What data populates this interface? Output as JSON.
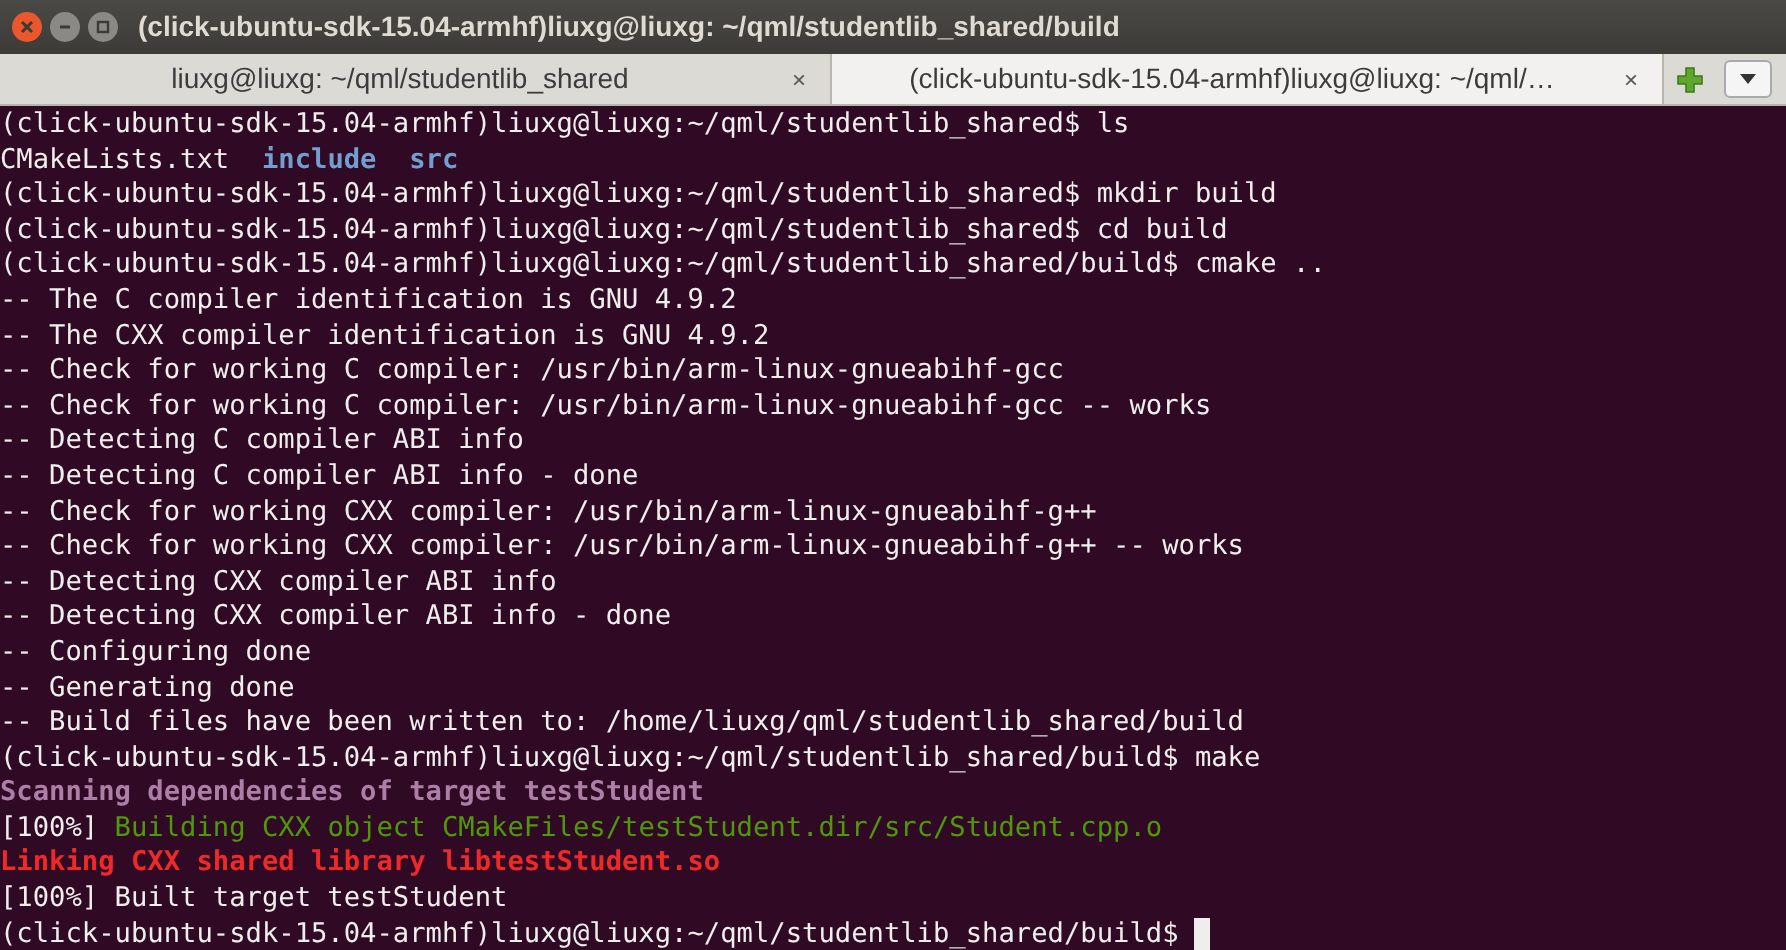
{
  "window": {
    "title": "(click-ubuntu-sdk-15.04-armhf)liuxg@liuxg: ~/qml/studentlib_shared/build"
  },
  "tabs": [
    {
      "label": "liuxg@liuxg: ~/qml/studentlib_shared",
      "close": "×",
      "selected": false
    },
    {
      "label": "(click-ubuntu-sdk-15.04-armhf)liuxg@liuxg: ~/qml/…",
      "close": "×",
      "selected": true
    }
  ],
  "terminal": {
    "lines": [
      [
        {
          "text": "(click-ubuntu-sdk-15.04-armhf)liuxg@liuxg:~/qml/studentlib_shared$ ls",
          "kind": "plain"
        }
      ],
      [
        {
          "text": "CMakeLists.txt  ",
          "kind": "plain"
        },
        {
          "text": "include  ",
          "kind": "dir"
        },
        {
          "text": "src",
          "kind": "dir"
        }
      ],
      [
        {
          "text": "(click-ubuntu-sdk-15.04-armhf)liuxg@liuxg:~/qml/studentlib_shared$ mkdir build",
          "kind": "plain"
        }
      ],
      [
        {
          "text": "(click-ubuntu-sdk-15.04-armhf)liuxg@liuxg:~/qml/studentlib_shared$ cd build",
          "kind": "plain"
        }
      ],
      [
        {
          "text": "(click-ubuntu-sdk-15.04-armhf)liuxg@liuxg:~/qml/studentlib_shared/build$ cmake ..",
          "kind": "plain"
        }
      ],
      [
        {
          "text": "-- The C compiler identification is GNU 4.9.2",
          "kind": "plain"
        }
      ],
      [
        {
          "text": "-- The CXX compiler identification is GNU 4.9.2",
          "kind": "plain"
        }
      ],
      [
        {
          "text": "-- Check for working C compiler: /usr/bin/arm-linux-gnueabihf-gcc",
          "kind": "plain"
        }
      ],
      [
        {
          "text": "-- Check for working C compiler: /usr/bin/arm-linux-gnueabihf-gcc -- works",
          "kind": "plain"
        }
      ],
      [
        {
          "text": "-- Detecting C compiler ABI info",
          "kind": "plain"
        }
      ],
      [
        {
          "text": "-- Detecting C compiler ABI info - done",
          "kind": "plain"
        }
      ],
      [
        {
          "text": "-- Check for working CXX compiler: /usr/bin/arm-linux-gnueabihf-g++",
          "kind": "plain"
        }
      ],
      [
        {
          "text": "-- Check for working CXX compiler: /usr/bin/arm-linux-gnueabihf-g++ -- works",
          "kind": "plain"
        }
      ],
      [
        {
          "text": "-- Detecting CXX compiler ABI info",
          "kind": "plain"
        }
      ],
      [
        {
          "text": "-- Detecting CXX compiler ABI info - done",
          "kind": "plain"
        }
      ],
      [
        {
          "text": "-- Configuring done",
          "kind": "plain"
        }
      ],
      [
        {
          "text": "-- Generating done",
          "kind": "plain"
        }
      ],
      [
        {
          "text": "-- Build files have been written to: /home/liuxg/qml/studentlib_shared/build",
          "kind": "plain"
        }
      ],
      [
        {
          "text": "(click-ubuntu-sdk-15.04-armhf)liuxg@liuxg:~/qml/studentlib_shared/build$ make",
          "kind": "plain"
        }
      ],
      [
        {
          "text": "Scanning dependencies of target testStudent",
          "kind": "scan"
        }
      ],
      [
        {
          "text": "[100%] ",
          "kind": "plain"
        },
        {
          "text": "Building CXX object CMakeFiles/testStudent.dir/src/Student.cpp.o",
          "kind": "build"
        }
      ],
      [
        {
          "text": "Linking CXX shared library libtestStudent.so",
          "kind": "link"
        }
      ],
      [
        {
          "text": "[100%] Built target testStudent",
          "kind": "plain"
        }
      ],
      [
        {
          "text": "(click-ubuntu-sdk-15.04-armhf)liuxg@liuxg:~/qml/studentlib_shared/build$ ",
          "kind": "plain"
        }
      ]
    ]
  }
}
